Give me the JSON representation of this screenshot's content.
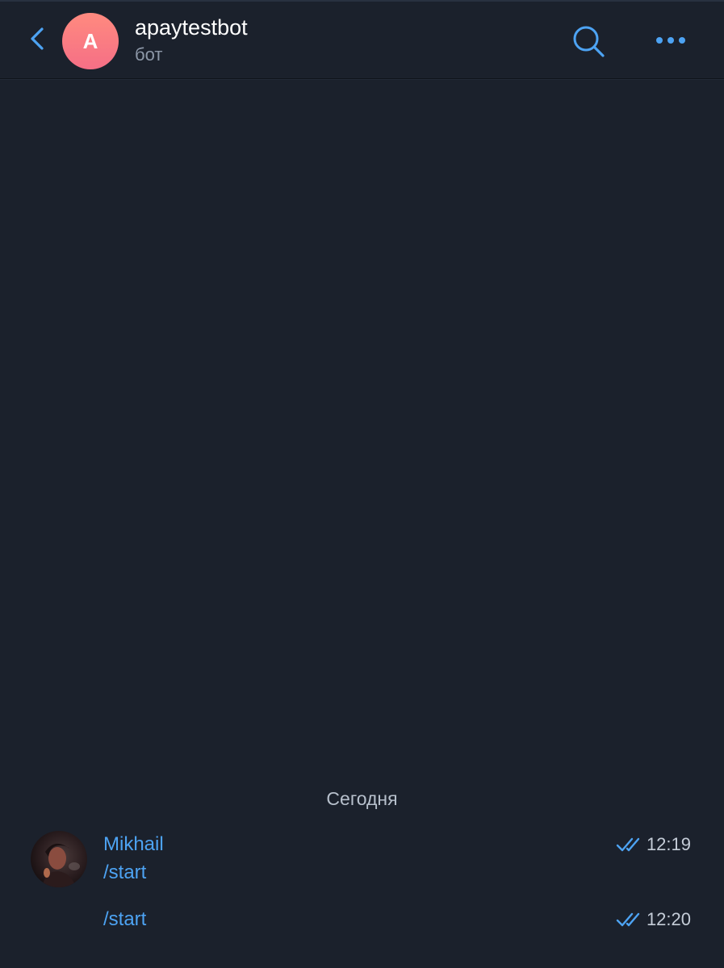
{
  "header": {
    "title": "apaytestbot",
    "subtitle": "бот",
    "avatar_letter": "A"
  },
  "icons": {
    "back": "chevron-left-icon",
    "search": "search-icon",
    "more": "more-dots-icon",
    "read_status": "double-check-icon"
  },
  "colors": {
    "background": "#1b212c",
    "accent": "#4da3f3",
    "avatar_gradient_top": "#ff8a7f",
    "avatar_gradient_bottom": "#f56f86",
    "subtitle": "#8d98a8"
  },
  "chat": {
    "date_separator": "Сегодня",
    "messages": [
      {
        "sender": "Mikhail",
        "text": "/start",
        "time": "12:19"
      },
      {
        "text": "/start",
        "time": "12:20"
      }
    ]
  }
}
